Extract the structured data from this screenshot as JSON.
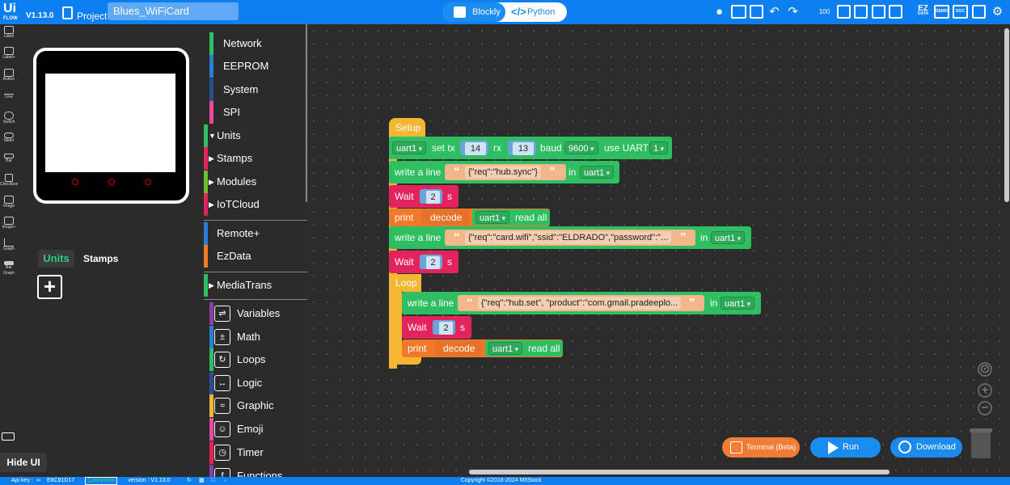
{
  "topbar": {
    "logo": "Ui",
    "logo_sub": "FLOW",
    "version": "V1.13.0",
    "project_label": "Project",
    "project_name": "Blues_WiFiCard",
    "mode_blockly": "Blockly",
    "mode_python": "Python",
    "ez_label": "EZ",
    "ez_sub": "DATA",
    "demo_label": "DEMO",
    "doc_label": "DOC",
    "counter_label": "100"
  },
  "rail": [
    "Label",
    "Label+",
    "Button",
    "Line",
    "Switch",
    "Slider",
    "Bar",
    "Checkbox",
    "Image",
    "Image+",
    "Graph",
    "Bar Graph"
  ],
  "ui_panel": {
    "tab_units": "Units",
    "tab_stamps": "Stamps",
    "add_symbol": "+",
    "hide_ui": "Hide UI"
  },
  "categories": [
    {
      "label": "Network",
      "color": "#2fbf62"
    },
    {
      "label": "EEPROM",
      "color": "#2a7fd4"
    },
    {
      "label": "System",
      "color": "#2a4f8a"
    },
    {
      "label": "SPI",
      "color": "#e94b9a"
    },
    {
      "label": "Units",
      "color": "#2fbf62"
    },
    {
      "label": "Stamps",
      "color": "#e3245c"
    },
    {
      "label": "Modules",
      "color": "#6abf2f"
    },
    {
      "label": "IoTCloud",
      "color": "#e3245c"
    },
    {
      "label": "Remote+",
      "color": "#2a7fd4"
    },
    {
      "label": "EzData",
      "color": "#f07a2a"
    },
    {
      "label": "MediaTrans",
      "color": "#2fbf62"
    },
    {
      "label": "Variables",
      "color": "#8a3fa8"
    },
    {
      "label": "Math",
      "color": "#2a7fd4"
    },
    {
      "label": "Loops",
      "color": "#2fbf62"
    },
    {
      "label": "Logic",
      "color": "#2a4f8a"
    },
    {
      "label": "Graphic",
      "color": "#f5b731"
    },
    {
      "label": "Emoji",
      "color": "#e94b9a"
    },
    {
      "label": "Timer",
      "color": "#e3245c"
    },
    {
      "label": "Functions",
      "color": "#8a3fa8"
    }
  ],
  "blocks": {
    "setup": "Setup",
    "uart_set": {
      "uart": "uart1",
      "set_tx": "set tx",
      "tx": "14",
      "rx_label": "rx",
      "rx": "13",
      "baud_label": "baud",
      "baud": "9600",
      "use_uart": "use UART",
      "uart_num": "1"
    },
    "write1": {
      "label": "write a line",
      "text": "{\"req\":\"hub.sync\"}",
      "in": "in",
      "uart": "uart1"
    },
    "wait1": {
      "label": "Wait",
      "value": "2",
      "unit": "s"
    },
    "print1": {
      "label": "print",
      "decode": "decode",
      "uart": "uart1",
      "read": "read all"
    },
    "write2": {
      "label": "write a line",
      "text": "{\"req\":\"card.wifi\",\"ssid\":\"ELDRADO\",\"password\":\"...",
      "in": "in",
      "uart": "uart1"
    },
    "wait2": {
      "label": "Wait",
      "value": "2",
      "unit": "s"
    },
    "loop": "Loop",
    "write3": {
      "label": "write a line",
      "text": "{\"req\":\"hub.set\", \"product\":\"com.gmail.pradeeplo...",
      "in": "in",
      "uart": "uart1"
    },
    "wait3": {
      "label": "Wait",
      "value": "2",
      "unit": "s"
    },
    "print2": {
      "label": "print",
      "decode": "decode",
      "uart": "uart1",
      "read": "read all"
    }
  },
  "controls": {
    "terminal": "Terminal (Beta)",
    "run": "Run",
    "download": "Download"
  },
  "statusbar": {
    "api_key_label": "Api key :",
    "api_key": "E8C81D17",
    "connected": "Connected",
    "version": "version : V1.13.0",
    "copyright": "Copyright ©2018-2024 M5Stack"
  }
}
